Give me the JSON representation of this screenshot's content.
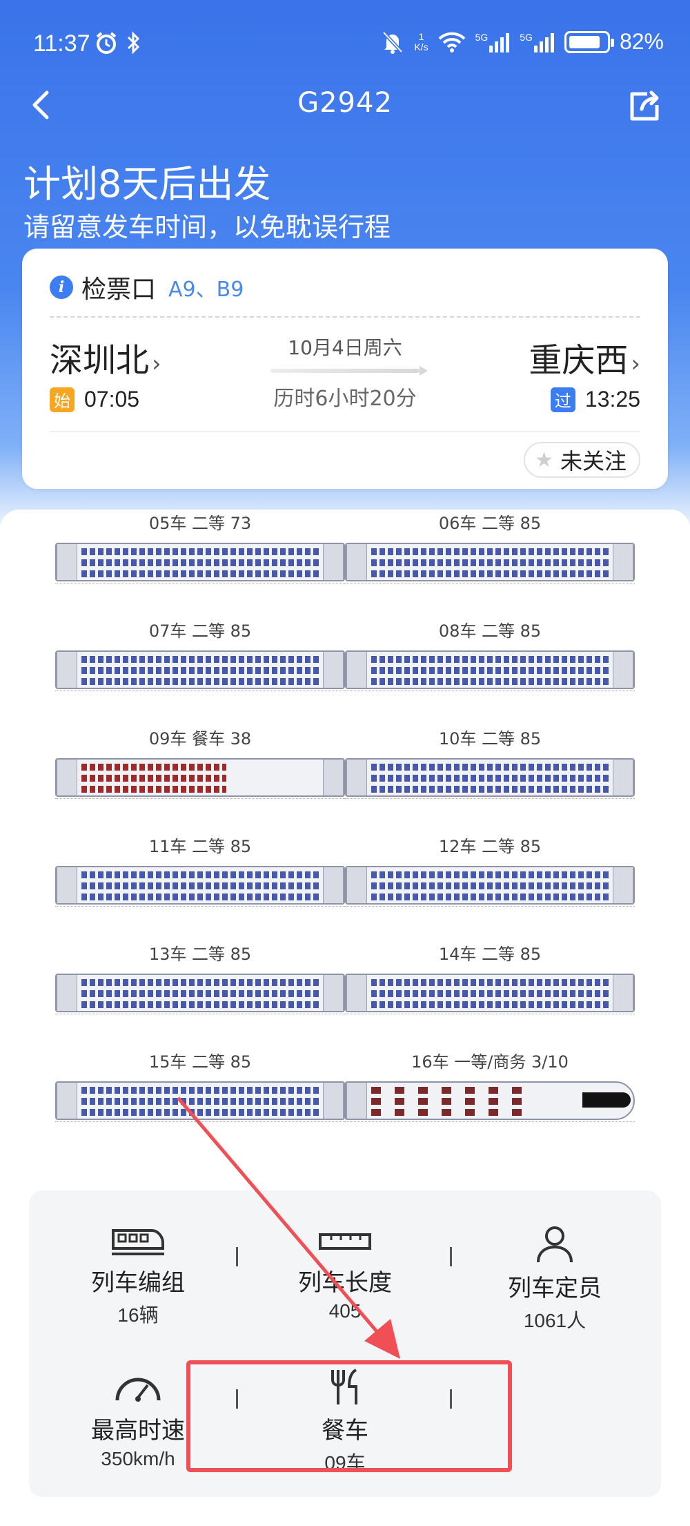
{
  "status_bar": {
    "time": "11:37",
    "net_speed_value": "1",
    "net_speed_unit": "K/s",
    "signal1": "5G",
    "signal2": "5G",
    "battery_percent": "82%",
    "battery_level": 0.82
  },
  "nav": {
    "title": "G2942"
  },
  "header": {
    "plan_text": "计划8天后出发",
    "tip_text": "请留意发车时间，以免耽误行程"
  },
  "ticket_card": {
    "gate_label": "检票口",
    "gate_value": "A9、B9",
    "from_station": "深圳北",
    "from_tag": "始",
    "from_time": "07:05",
    "to_station": "重庆西",
    "to_tag": "过",
    "to_time": "13:25",
    "date": "10月4日周六",
    "duration": "历时6小时20分",
    "follow_label": "未关注"
  },
  "cars": [
    {
      "label": "05车 二等 73"
    },
    {
      "label": "06车 二等 85"
    },
    {
      "label": "07车 二等 85"
    },
    {
      "label": "08车 二等 85"
    },
    {
      "label": "09车 餐车 38"
    },
    {
      "label": "10车 二等 85"
    },
    {
      "label": "11车 二等 85"
    },
    {
      "label": "12车 二等 85"
    },
    {
      "label": "13车 二等 85"
    },
    {
      "label": "14车 二等 85"
    },
    {
      "label": "15车 二等 85"
    },
    {
      "label": "16车 一等/商务 3/10"
    }
  ],
  "stats": {
    "composition_label": "列车编组",
    "composition_value": "16辆",
    "length_label": "列车长度",
    "length_value": "405",
    "capacity_label": "列车定员",
    "capacity_value": "1061人",
    "speed_label": "最高时速",
    "speed_value": "350km/h",
    "dining_label": "餐车",
    "dining_value": "09车"
  },
  "colors": {
    "brand_blue": "#3a73ea",
    "highlight_red": "#ef4f55",
    "tag_orange": "#f5a623"
  }
}
